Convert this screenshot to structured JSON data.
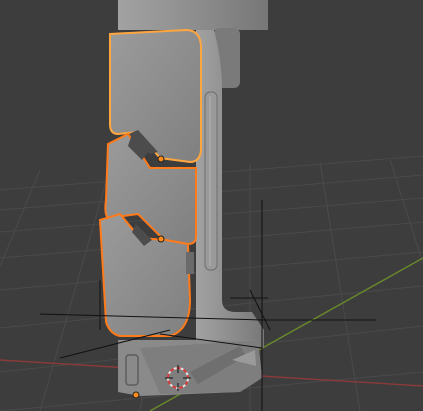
{
  "viewport": {
    "mode": "3d-viewport",
    "background_color": "#3d3d3d",
    "grid_color": "#4a4a4a",
    "x_axis_color": "#8a3a3a",
    "y_axis_color": "#6a8a2a",
    "selection_outline_color": "#ff7a1a",
    "active_outline_color": "#ffa640",
    "model_color": "#8e8e8e",
    "icons": {
      "origin": "object-origin-icon",
      "cursor": "3d-cursor-icon"
    }
  }
}
